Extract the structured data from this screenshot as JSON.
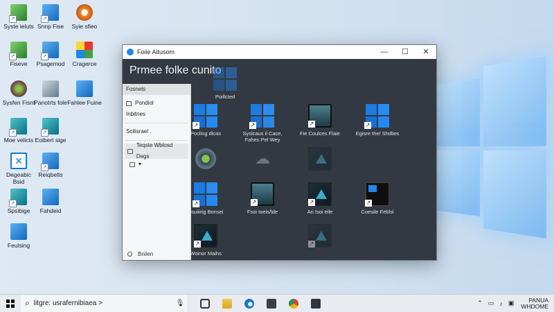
{
  "desktop": {
    "icons": [
      {
        "label": "Syste ieluts",
        "style": "green"
      },
      {
        "label": "Snnp Fise",
        "style": "blue"
      },
      {
        "label": "Syie sfieo",
        "style": "orange"
      },
      {
        "label": "Fiseve",
        "style": "green"
      },
      {
        "label": "Psagemod",
        "style": "blue"
      },
      {
        "label": "Cragerce",
        "style": "multi"
      },
      {
        "label": "Sysfen Fisnt",
        "style": "brown"
      },
      {
        "label": "Panotrts fole",
        "style": "gray"
      },
      {
        "label": "Fahlee Fuine",
        "style": "blue"
      },
      {
        "label": "Moe velicts",
        "style": "teal"
      },
      {
        "label": "Eoibert sige",
        "style": "teal"
      },
      {
        "label": "Degeabic Bsid",
        "style": "white"
      },
      {
        "label": "Reiqbelts",
        "style": "blue"
      },
      {
        "label": "Spsibige",
        "style": "teal"
      },
      {
        "label": "Fahdeid",
        "style": "blue"
      },
      {
        "label": "Feulsing",
        "style": "blue"
      }
    ]
  },
  "window": {
    "title": "Foiie Aitusom",
    "header": "Prmee folke cunito",
    "controls": {
      "minimize": "—",
      "maximize": "☐",
      "close": "✕"
    },
    "sidebar": {
      "section1": "Fosnels",
      "item_pinned": "Pondiol",
      "item2": "Inbitnes",
      "section2": "Scilisrael .",
      "selected_item": "Teqste Wblosd Degs",
      "sub_item": "▾",
      "bottom_item": "Bnilen"
    },
    "tiles": [
      {
        "label": "Poillcted",
        "type": "win dim"
      },
      {
        "label": "Pocling dlcas",
        "type": "win"
      },
      {
        "label": "Syslcaus il Cace, Fahes Pel Wey",
        "type": "win"
      },
      {
        "label": "Fie Coulces Flaie",
        "type": "monitor"
      },
      {
        "label": "Egisre the/ Shdlies",
        "type": "win"
      },
      {
        "label": "",
        "type": "gear"
      },
      {
        "label": "",
        "type": "cloud"
      },
      {
        "label": "",
        "type": "teal-tri dim"
      },
      {
        "label": "Fsuiiirig Bonsei",
        "type": "win"
      },
      {
        "label": "Fsoi toeis/lde",
        "type": "monitor"
      },
      {
        "label": "Ari Isoi eile",
        "type": "teal-tri"
      },
      {
        "label": "Coesile Feblsl",
        "type": "window-dark"
      },
      {
        "label": "Woinor Maihs",
        "type": "teal-tri"
      },
      {
        "label": "",
        "type": "teal-tri dim"
      }
    ]
  },
  "taskbar": {
    "search_text": "litgre: usrafernibiaea >",
    "tray_label_1": "PANUA",
    "tray_label_2": "WHDOME"
  }
}
